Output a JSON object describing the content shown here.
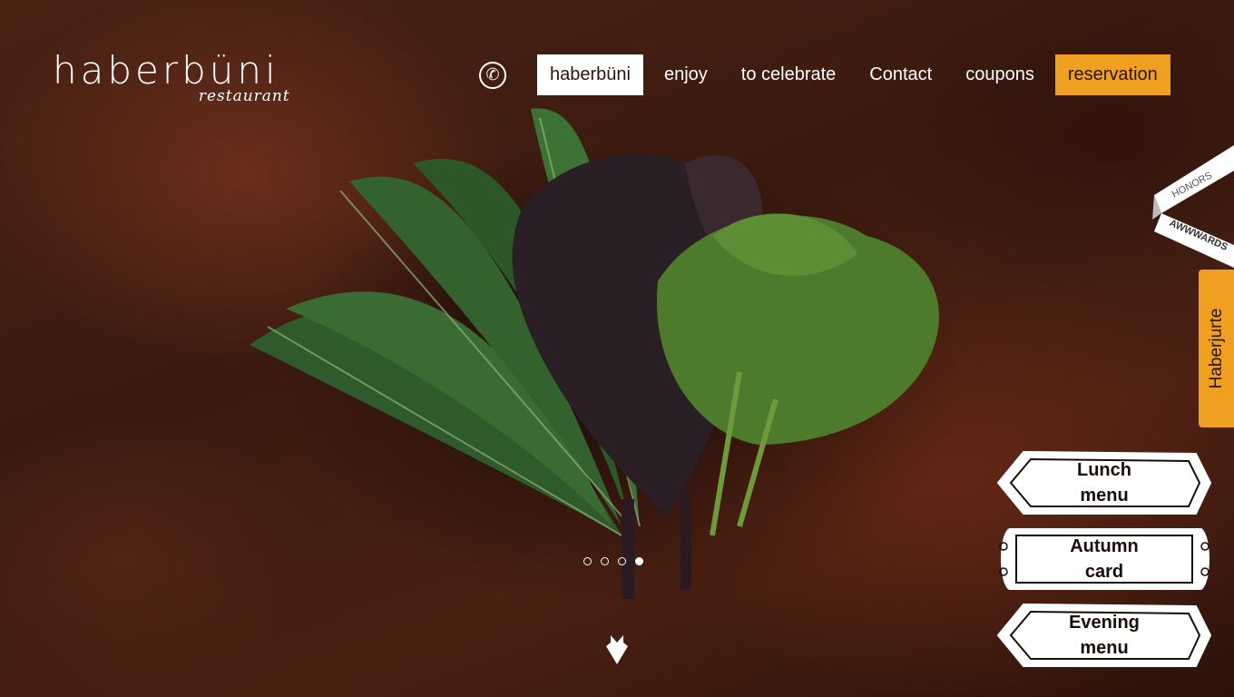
{
  "logo": {
    "name": "haberbüni",
    "subtitle": "restaurant"
  },
  "nav": {
    "phone_icon": "phone-icon",
    "items": [
      {
        "label": "haberbüni",
        "active": true
      },
      {
        "label": "enjoy"
      },
      {
        "label": "to celebrate"
      },
      {
        "label": "Contact"
      },
      {
        "label": "coupons"
      }
    ],
    "reservation_label": "reservation"
  },
  "hero": {
    "slides_total": 4,
    "active_slide": 4,
    "scroll_icon": "arrow-down-icon"
  },
  "badge": {
    "honors": "HONORS",
    "awwwards": "AWWWARDS"
  },
  "side_tab": {
    "label": "Haberjurte"
  },
  "menus": [
    {
      "label": "Lunch menu"
    },
    {
      "label": "Autumn card"
    },
    {
      "label": "Evening menu"
    }
  ],
  "colors": {
    "accent": "#f0a020",
    "background": "#3a1a10",
    "text_light": "#ffffff"
  }
}
